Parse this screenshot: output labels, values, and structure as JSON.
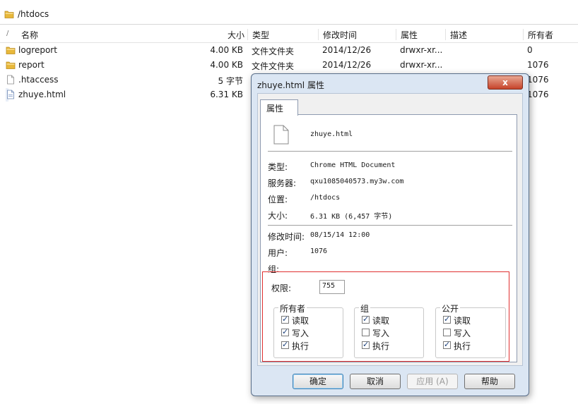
{
  "path": "/htdocs",
  "columns": {
    "sort_mark": "/",
    "name": "名称",
    "size": "大小",
    "type": "类型",
    "modified": "修改时间",
    "perms": "属性",
    "desc": "描述",
    "owner": "所有者"
  },
  "files": [
    {
      "name": "logreport",
      "icon": "folder-icon",
      "size": "4.00 KB",
      "type": "文件文件夹",
      "modified": "2014/12/26",
      "perms": "drwxr-xr...",
      "owner": "0"
    },
    {
      "name": "report",
      "icon": "folder-icon",
      "size": "4.00 KB",
      "type": "文件文件夹",
      "modified": "2014/12/26",
      "perms": "drwxr-xr...",
      "owner": "1076"
    },
    {
      "name": ".htaccess",
      "icon": "file-icon",
      "size": "5 字节",
      "owner": "1076"
    },
    {
      "name": "zhuye.html",
      "icon": "html-file-icon",
      "size": "6.31 KB",
      "owner": "1076"
    }
  ],
  "dialog": {
    "title": "zhuye.html 属性",
    "close_label": "x",
    "tab_label": "属性",
    "file_name": "zhuye.html",
    "props": {
      "type_label": "类型:",
      "type_value": "Chrome HTML Document",
      "server_label": "服务器:",
      "server_value": "qxu1085040573.my3w.com",
      "location_label": "位置:",
      "location_value": "/htdocs",
      "size_label": "大小:",
      "size_value": "6.31 KB (6,457 字节)",
      "modified_label": "修改时间:",
      "modified_value": "08/15/14 12:00",
      "user_label": "用户:",
      "user_value": "1076",
      "group_label": "组:"
    },
    "permission": {
      "label": "权限:",
      "value": "755"
    },
    "groups": [
      {
        "title": "所有者",
        "items": [
          {
            "label": "读取",
            "checked": true
          },
          {
            "label": "写入",
            "checked": true
          },
          {
            "label": "执行",
            "checked": true
          }
        ]
      },
      {
        "title": "组",
        "items": [
          {
            "label": "读取",
            "checked": true
          },
          {
            "label": "写入",
            "checked": false
          },
          {
            "label": "执行",
            "checked": true
          }
        ]
      },
      {
        "title": "公开",
        "items": [
          {
            "label": "读取",
            "checked": true
          },
          {
            "label": "写入",
            "checked": false
          },
          {
            "label": "执行",
            "checked": true
          }
        ]
      }
    ],
    "buttons": {
      "ok": "确定",
      "cancel": "取消",
      "apply": "应用 (A)",
      "help": "帮助"
    }
  }
}
